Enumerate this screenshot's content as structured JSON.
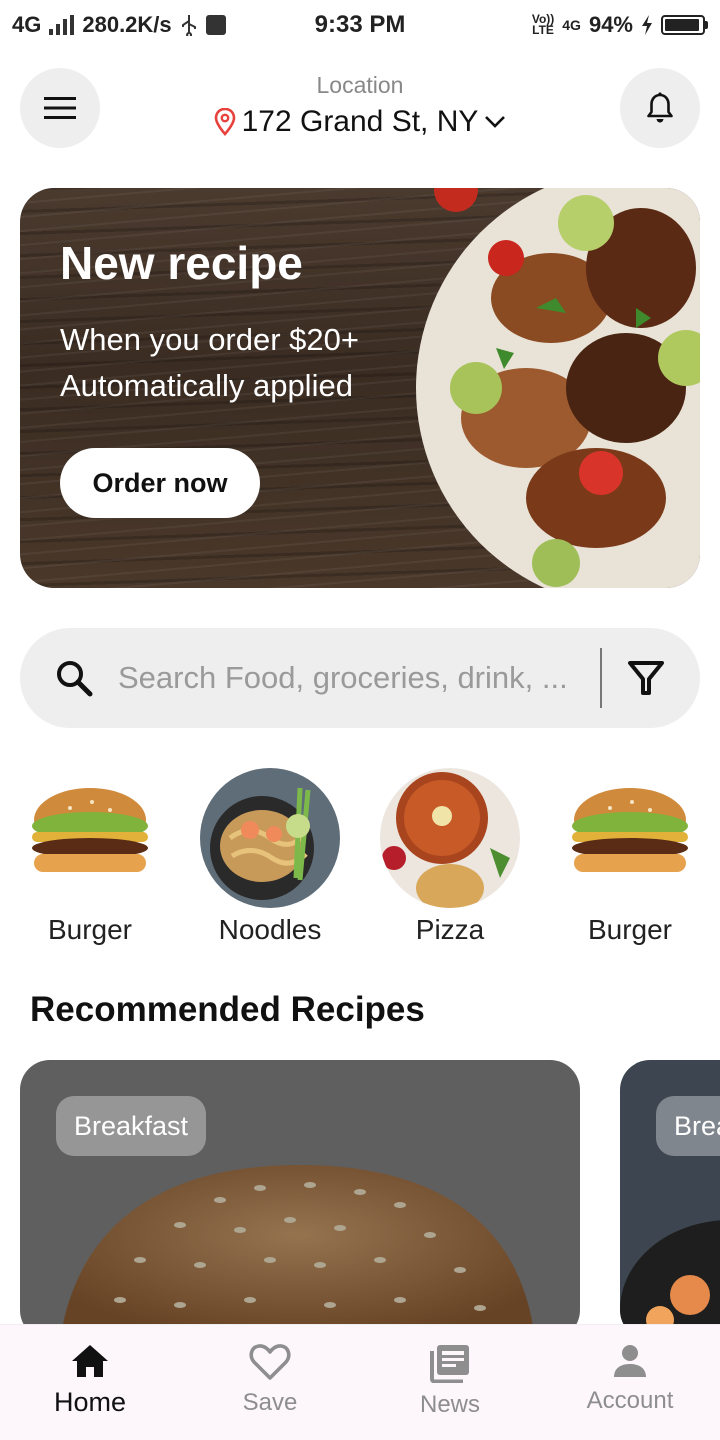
{
  "status_bar": {
    "network": "4G",
    "speed": "280.2K/s",
    "time": "9:33 PM",
    "volte_top": "Vo))",
    "volte_bottom": "LTE",
    "network_right": "4G",
    "battery_percent": "94%",
    "battery_level": 0.94
  },
  "header": {
    "location_label": "Location",
    "address": "172 Grand St, NY",
    "icons": [
      "menu-icon",
      "location-pin-icon",
      "chevron-down-icon",
      "bell-icon"
    ],
    "pin_color": "#e8413b"
  },
  "banner": {
    "title": "New recipe",
    "line1": "When you order $20+",
    "line2": "Automatically applied",
    "button": "Order now"
  },
  "search": {
    "placeholder": "Search Food, groceries, drink, ...",
    "icons": [
      "search-icon",
      "filter-icon"
    ]
  },
  "categories": [
    {
      "name": "Burger"
    },
    {
      "name": "Noodles"
    },
    {
      "name": "Pizza"
    },
    {
      "name": "Burger"
    }
  ],
  "recommended": {
    "title": "Recommended Recipes",
    "cards": [
      {
        "tag": "Breakfast"
      },
      {
        "tag": "Brea"
      }
    ]
  },
  "bottom_nav": {
    "items": [
      {
        "label": "Home",
        "icon": "home-icon",
        "active": true
      },
      {
        "label": "Save",
        "icon": "heart-icon",
        "active": false
      },
      {
        "label": "News",
        "icon": "news-icon",
        "active": false
      },
      {
        "label": "Account",
        "icon": "account-icon",
        "active": false
      }
    ]
  }
}
